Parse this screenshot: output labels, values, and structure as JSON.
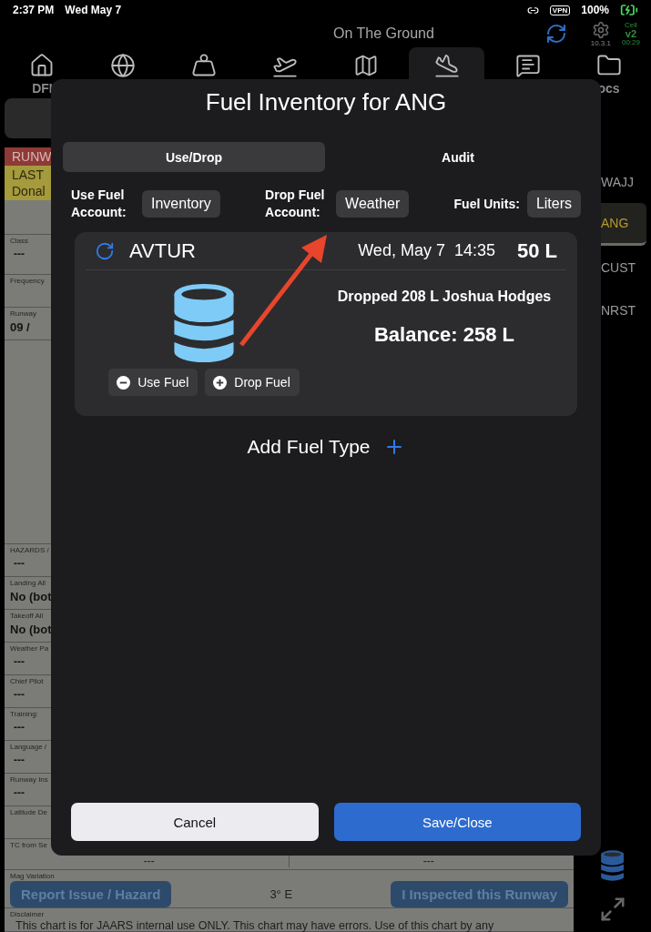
{
  "status_bar": {
    "time": "2:37 PM",
    "date": "Wed May 7",
    "vpn": "VPN",
    "battery": "100%"
  },
  "header": {
    "title": "On The Ground",
    "version": "10.3.1",
    "connection": "Cell",
    "sync_version": "v2",
    "timer": "00:29"
  },
  "tabs": [
    {
      "kind": "home",
      "label": "DFI",
      "selected": false
    },
    {
      "kind": "globe",
      "selected": false
    },
    {
      "kind": "weight",
      "selected": false
    },
    {
      "kind": "takeoff",
      "selected": false
    },
    {
      "kind": "map",
      "selected": false
    },
    {
      "kind": "landing",
      "selected": true
    },
    {
      "kind": "messages",
      "selected": false
    },
    {
      "kind": "folder",
      "label": "ocs",
      "selected": false
    }
  ],
  "runway_chart": {
    "banner": {
      "title": "RUNW",
      "lines": [
        "LAST",
        "Donal"
      ]
    },
    "summary_fields": [
      {
        "label": "Class",
        "value": "---",
        "kind": "plain"
      },
      {
        "label": "Frequency"
      },
      {
        "label": "Runway",
        "value": "09 /",
        "kind": "bold"
      }
    ],
    "detail_fields": [
      {
        "label": "HAZARDS /",
        "value": "---",
        "kind": "plain"
      },
      {
        "label": "Landing All",
        "value": "No (bot",
        "kind": "bold"
      },
      {
        "label": "Takeoff All",
        "value": "No (bot",
        "kind": "bold"
      },
      {
        "label": "Weather Pa",
        "value": "---",
        "kind": "plain"
      },
      {
        "label": "Chief Pilot",
        "value": "---",
        "kind": "plain"
      },
      {
        "label": "Training:",
        "value": "---",
        "kind": "plain"
      },
      {
        "label": "Language /",
        "value": "---",
        "kind": "plain"
      },
      {
        "label": "Runway Ins",
        "value": "---",
        "kind": "plain"
      },
      {
        "label": "Latitude De"
      }
    ],
    "split_field": {
      "label": "TC from Se",
      "values": [
        "---",
        "---"
      ]
    },
    "mag_variation": {
      "label": "Mag Variation",
      "value": "3° E"
    },
    "actions": [
      "Report Issue / Hazard",
      "I Inspected this Runway"
    ],
    "disclaimer": {
      "label": "Disclaimer",
      "text": "This chart is for JAARS internal use ONLY. This chart may have errors. Use of this chart by any"
    }
  },
  "airport_list": [
    {
      "code": "WAJJ",
      "selected": false
    },
    {
      "code": "ANG",
      "selected": true
    },
    {
      "code": "CUST",
      "selected": false
    },
    {
      "code": "NRST",
      "selected": false
    }
  ],
  "modal": {
    "title": "Fuel Inventory for ANG",
    "segments": [
      {
        "label": "Use/Drop",
        "selected": true
      },
      {
        "label": "Audit",
        "selected": false
      }
    ],
    "accounts": [
      {
        "label": "Use Fuel Account:",
        "value": "Inventory"
      },
      {
        "label": "Drop Fuel Account:",
        "value": "Weather"
      },
      {
        "label": "Fuel Units:",
        "value": "Liters"
      }
    ],
    "fuel_card": {
      "name": "AVTUR",
      "date": "Wed, May 7",
      "time": "14:35",
      "amount": "50 L",
      "last_entry": "Dropped 208 L Joshua Hodges",
      "balance": "Balance: 258 L",
      "buttons": [
        {
          "kind": "use",
          "label": "Use Fuel"
        },
        {
          "kind": "drop",
          "label": "Drop Fuel"
        }
      ]
    },
    "add_label": "Add Fuel Type",
    "buttons": [
      {
        "kind": "cancel",
        "label": "Cancel"
      },
      {
        "kind": "primary",
        "label": "Save/Close"
      }
    ]
  }
}
